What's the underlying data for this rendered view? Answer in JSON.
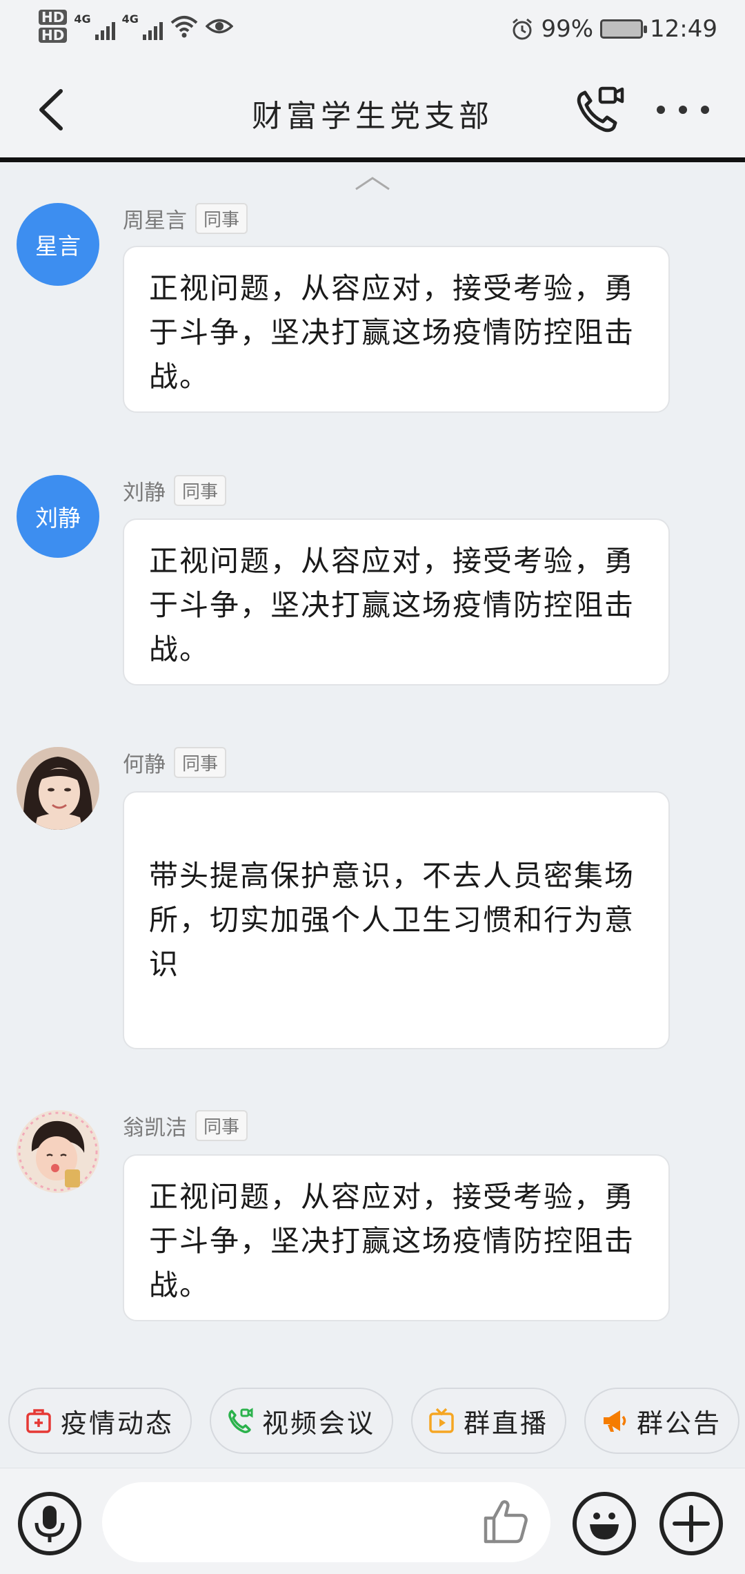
{
  "status_bar": {
    "hd1": "HD",
    "hd2": "HD",
    "net1": "4G",
    "net2": "4G",
    "battery": "99%",
    "time": "12:49"
  },
  "header": {
    "title": "财富学生党支部"
  },
  "messages": [
    {
      "avatar_text": "星言",
      "sender": "周星言",
      "tag": "同事",
      "text": "正视问题，从容应对，接受考验，勇于斗争，坚决打赢这场疫情防控阻击战。"
    },
    {
      "avatar_text": "刘静",
      "sender": "刘静",
      "tag": "同事",
      "text": "正视问题，从容应对，接受考验，勇于斗争，坚决打赢这场疫情防控阻击战。"
    },
    {
      "avatar_text": "",
      "sender": "何静",
      "tag": "同事",
      "text": "带头提高保护意识，不去人员密集场所，切实加强个人卫生习惯和行为意识"
    },
    {
      "avatar_text": "",
      "sender": "翁凯洁",
      "tag": "同事",
      "text": "正视问题，从容应对，接受考验，勇于斗争，坚决打赢这场疫情防控阻击战。"
    }
  ],
  "quick_actions": [
    {
      "label": "疫情动态",
      "icon": "medical-kit-icon",
      "color": "#e53935"
    },
    {
      "label": "视频会议",
      "icon": "video-call-icon",
      "color": "#2bb24c"
    },
    {
      "label": "群直播",
      "icon": "live-tv-icon",
      "color": "#f5a623"
    },
    {
      "label": "群公告",
      "icon": "megaphone-icon",
      "color": "#f57c00"
    }
  ],
  "colors": {
    "avatar_blue": "#3d8ef0",
    "background": "#edf0f3"
  }
}
